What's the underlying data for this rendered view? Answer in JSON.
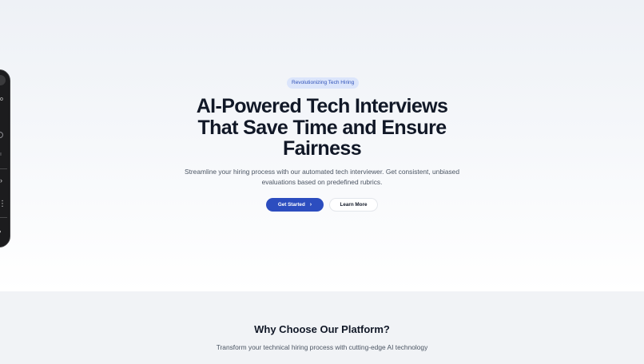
{
  "hero": {
    "badge": "Revolutionizing Tech Hiring",
    "headline_lines": [
      "AI-Powered Tech Interviews",
      "That Save Time and Ensure",
      "Fairness"
    ],
    "subtitle_lines": [
      "Streamline your hiring process with our automated tech interviewer. Get consistent, unbiased",
      "evaluations based on predefined rubrics."
    ],
    "primary_button": "Get Started",
    "primary_button_icon": "chevron-right-icon",
    "secondary_button": "Learn More"
  },
  "features": {
    "title": "Why Choose Our Platform?",
    "subtitle": "Transform your technical hiring process with cutting-edge AI technology"
  },
  "side_panel": {
    "glyphs": {
      "o": "o",
      "vertical": "ı",
      "arrow": "›",
      "kebab": "⋮",
      "square": "▪"
    }
  },
  "colors": {
    "accent": "#2c4dbf",
    "badge_bg": "#dbe5fb",
    "badge_text": "#2f52b8",
    "heading": "#111827",
    "body_text": "#4b5563",
    "section_bg": "#f1f3f6",
    "panel_bg": "#1c1c1e"
  }
}
